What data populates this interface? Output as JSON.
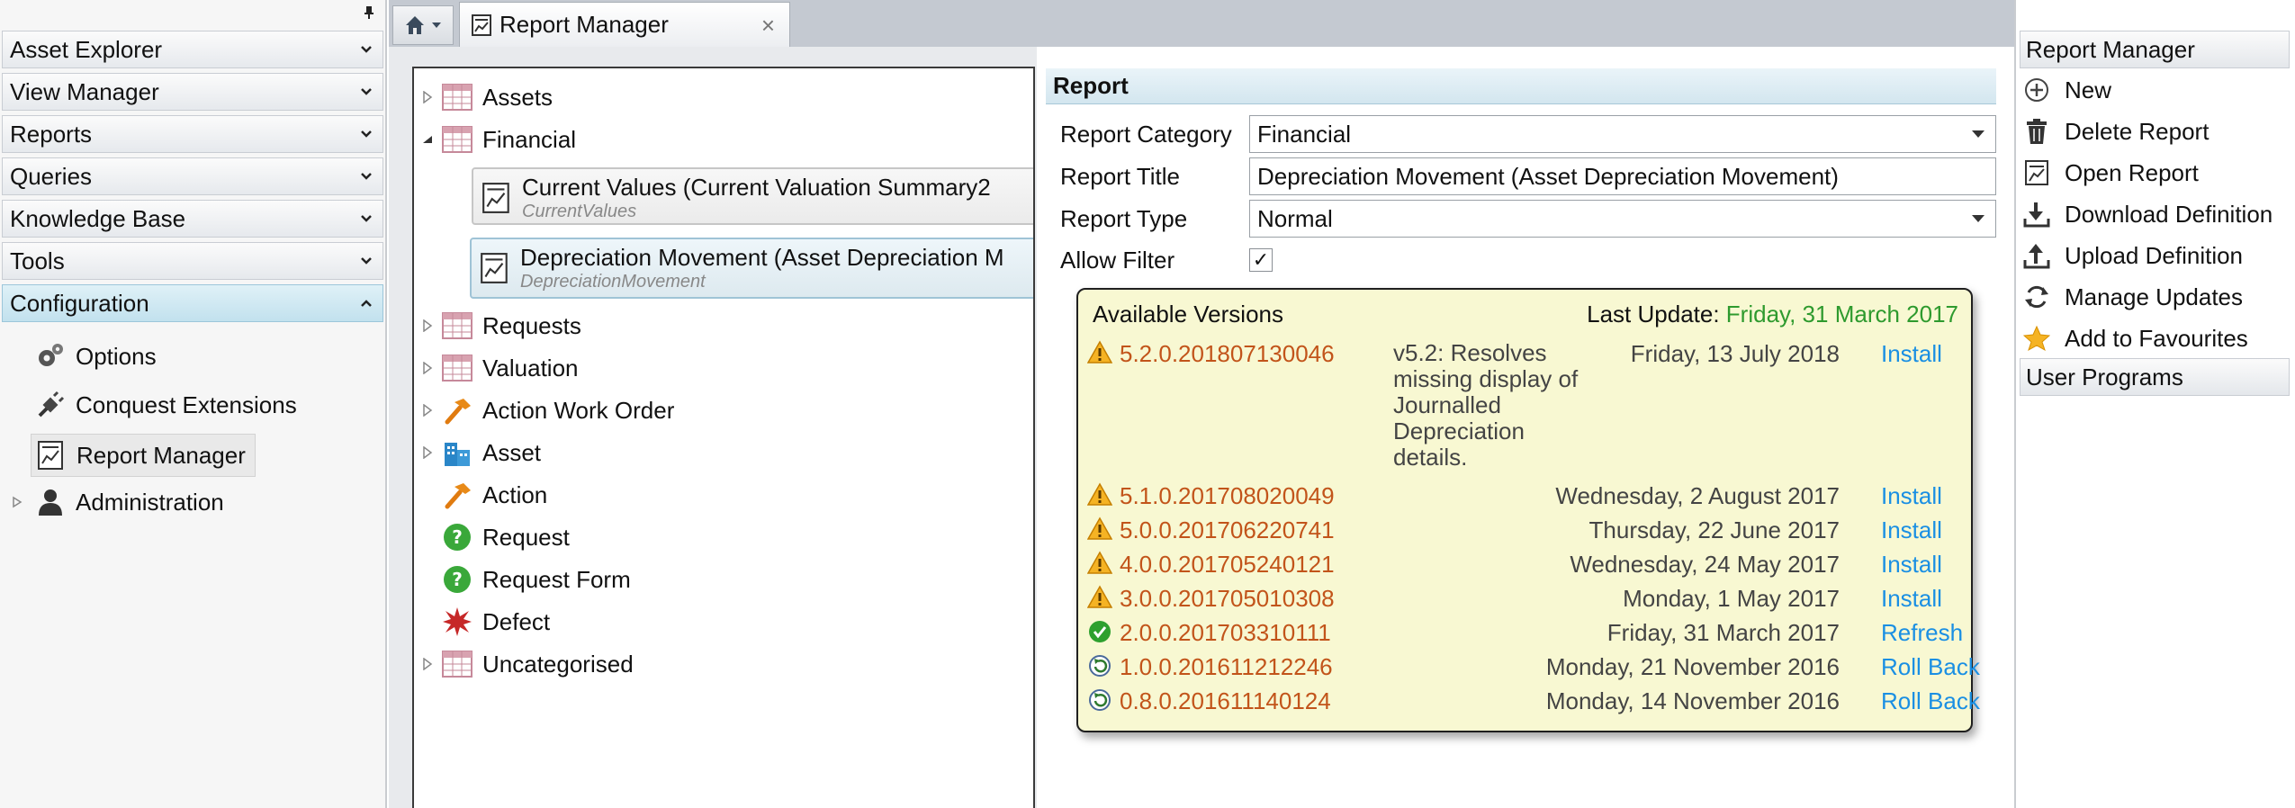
{
  "left_nav": {
    "sections": [
      {
        "label": "Asset Explorer"
      },
      {
        "label": "View Manager"
      },
      {
        "label": "Reports"
      },
      {
        "label": "Queries"
      },
      {
        "label": "Knowledge Base"
      },
      {
        "label": "Tools"
      },
      {
        "label": "Configuration"
      }
    ],
    "config_items": [
      {
        "label": "Options",
        "icon": "gears-icon"
      },
      {
        "label": "Conquest Extensions",
        "icon": "plug-icon"
      },
      {
        "label": "Report Manager",
        "icon": "report-icon"
      },
      {
        "label": "Administration",
        "icon": "user-admin-icon"
      }
    ]
  },
  "tabs": {
    "active_label": "Report Manager"
  },
  "tree": {
    "nodes": [
      {
        "label": "Assets"
      },
      {
        "label": "Financial"
      },
      {
        "label": "Requests"
      },
      {
        "label": "Valuation"
      },
      {
        "label": "Action Work Order"
      },
      {
        "label": "Asset"
      },
      {
        "label": "Action"
      },
      {
        "label": "Request"
      },
      {
        "label": "Request Form"
      },
      {
        "label": "Defect"
      },
      {
        "label": "Uncategorised"
      }
    ],
    "reports": [
      {
        "title": "Current Values (Current Valuation Summary2",
        "code": "CurrentValues"
      },
      {
        "title": "Depreciation Movement (Asset Depreciation M",
        "code": "DepreciationMovement"
      }
    ]
  },
  "report": {
    "header": "Report",
    "category_label": "Report Category",
    "category_value": "Financial",
    "title_label": "Report Title",
    "title_value": "Depreciation Movement (Asset Depreciation Movement)",
    "type_label": "Report Type",
    "type_value": "Normal",
    "filter_label": "Allow Filter",
    "filter_checked": "✓"
  },
  "versions": {
    "heading": "Available Versions",
    "last_update_label": "Last Update:",
    "last_update_date": "Friday, 31 March 2017",
    "rows": [
      {
        "version": "5.2.0.201807130046",
        "description": "v5.2: Resolves missing display of Journalled Depreciation details.",
        "date": "Friday, 13 July 2018",
        "action": "Install",
        "icon": "warning-icon"
      },
      {
        "version": "5.1.0.201708020049",
        "description": "",
        "date": "Wednesday, 2 August 2017",
        "action": "Install",
        "icon": "warning-icon"
      },
      {
        "version": "5.0.0.201706220741",
        "description": "",
        "date": "Thursday, 22 June 2017",
        "action": "Install",
        "icon": "warning-icon"
      },
      {
        "version": "4.0.0.201705240121",
        "description": "",
        "date": "Wednesday, 24 May 2017",
        "action": "Install",
        "icon": "warning-icon"
      },
      {
        "version": "3.0.0.201705010308",
        "description": "",
        "date": "Monday, 1 May 2017",
        "action": "Install",
        "icon": "warning-icon"
      },
      {
        "version": "2.0.0.201703310111",
        "description": "",
        "date": "Friday, 31 March 2017",
        "action": "Refresh",
        "icon": "check-icon"
      },
      {
        "version": "1.0.0.201611212246",
        "description": "",
        "date": "Monday, 21 November 2016",
        "action": "Roll Back",
        "icon": "rollback-icon"
      },
      {
        "version": "0.8.0.201611140124",
        "description": "",
        "date": "Monday, 14 November 2016",
        "action": "Roll Back",
        "icon": "rollback-icon"
      }
    ]
  },
  "right_panel": {
    "header": "Report Manager",
    "actions": [
      {
        "label": "New",
        "icon": "plus-circle-icon"
      },
      {
        "label": "Delete Report",
        "icon": "trash-icon"
      },
      {
        "label": "Open Report",
        "icon": "report-icon"
      },
      {
        "label": "Download Definition",
        "icon": "download-icon"
      },
      {
        "label": "Upload Definition",
        "icon": "upload-icon"
      },
      {
        "label": "Manage Updates",
        "icon": "refresh-icon"
      },
      {
        "label": "Add to Favourites",
        "icon": "star-icon"
      }
    ],
    "user_programs_header": "User Programs"
  },
  "colors": {
    "version_number": "#c2541a",
    "action_link": "#1a8fe3",
    "last_update_date": "#2e9a2e",
    "versions_background": "#f8f8d2",
    "active_section": "#c2e1ee"
  }
}
